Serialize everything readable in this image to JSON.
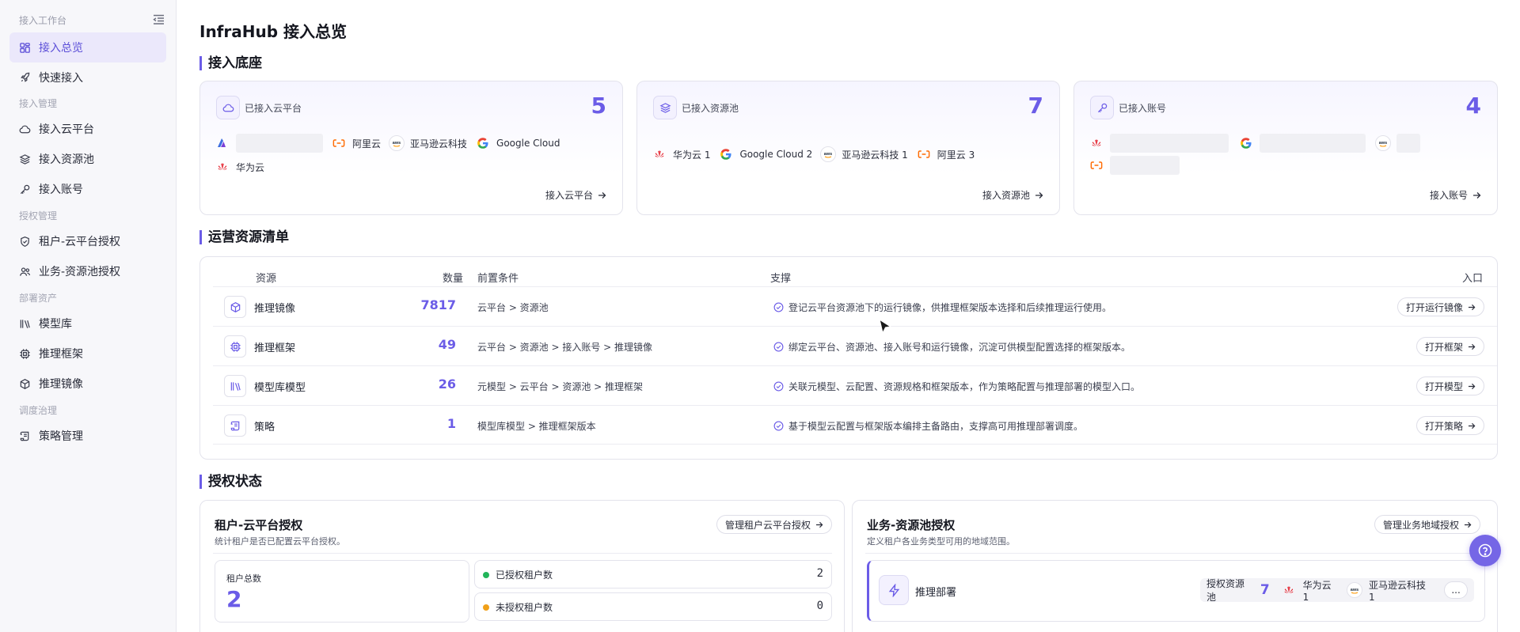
{
  "sidebar": {
    "header": "接入工作台",
    "groups": {
      "access_mgmt": "接入管理",
      "auth_mgmt": "授权管理",
      "deploy_assets": "部署资产",
      "schedule_gov": "调度治理"
    },
    "items": {
      "overview": "接入总览",
      "quick": "快速接入",
      "cloud": "接入云平台",
      "pool": "接入资源池",
      "account": "接入账号",
      "tenant_auth": "租户-云平台授权",
      "biz_auth": "业务-资源池授权",
      "model_lib": "模型库",
      "framework": "推理框架",
      "image": "推理镜像",
      "policy": "策略管理"
    }
  },
  "page_title": "InfraHub 接入总览",
  "sections": {
    "base": "接入底座",
    "resources": "运营资源清单",
    "auth": "授权状态"
  },
  "base_cards": {
    "cloud": {
      "label": "已接入云平台",
      "count": "5",
      "providers": [
        "阿里云",
        "亚马逊云科技",
        "Google Cloud",
        "华为云"
      ],
      "link": "接入云平台"
    },
    "pool": {
      "label": "已接入资源池",
      "count": "7",
      "providers": [
        "华为云 1",
        "Google Cloud 2",
        "亚马逊云科技 1",
        "阿里云 3"
      ],
      "link": "接入资源池"
    },
    "account": {
      "label": "已接入账号",
      "count": "4",
      "link": "接入账号"
    }
  },
  "table": {
    "headers": {
      "resource": "资源",
      "count": "数量",
      "prereq": "前置条件",
      "support": "支撑",
      "entry": "入口"
    },
    "rows": [
      {
        "name": "推理镜像",
        "count": "7817",
        "prereq": "云平台 > 资源池",
        "support": "登记云平台资源池下的运行镜像，供推理框架版本选择和后续推理运行使用。",
        "button": "打开运行镜像"
      },
      {
        "name": "推理框架",
        "count": "49",
        "prereq": "云平台 > 资源池 > 接入账号 > 推理镜像",
        "support": "绑定云平台、资源池、接入账号和运行镜像，沉淀可供模型配置选择的框架版本。",
        "button": "打开框架"
      },
      {
        "name": "模型库模型",
        "count": "26",
        "prereq": "元模型 > 云平台 > 资源池 > 推理框架",
        "support": "关联元模型、云配置、资源规格和框架版本，作为策略配置与推理部署的模型入口。",
        "button": "打开模型"
      },
      {
        "name": "策略",
        "count": "1",
        "prereq": "模型库模型 > 推理框架版本",
        "support": "基于模型云配置与框架版本编排主备路由，支撑高可用推理部署调度。",
        "button": "打开策略"
      }
    ]
  },
  "tenant_auth": {
    "title": "租户-云平台授权",
    "subtitle": "统计租户是否已配置云平台授权。",
    "manage": "管理租户云平台授权",
    "total_label": "租户总数",
    "total": "2",
    "authorized_label": "已授权租户数",
    "authorized": "2",
    "unauthorized_label": "未授权租户数",
    "unauthorized": "0",
    "colors": {
      "authorized": "#22b55a",
      "unauthorized": "#f0a019"
    }
  },
  "biz_auth": {
    "title": "业务-资源池授权",
    "subtitle": "定义租户各业务类型可用的地域范围。",
    "manage": "管理业务地域授权",
    "business": "推理部署",
    "pool_label": "授权资源池",
    "pool_count": "7",
    "pools": [
      "华为云 1",
      "亚马逊云科技 1"
    ],
    "more": "..."
  },
  "colors": {
    "accent": "#6b5ce7",
    "active_bg": "#ebe8fb"
  }
}
